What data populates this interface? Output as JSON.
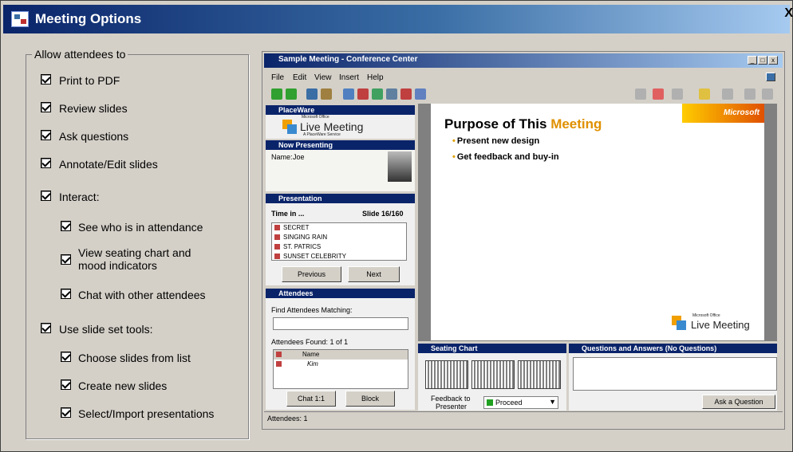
{
  "window": {
    "title": "Meeting Options",
    "close": "X"
  },
  "options": {
    "legend": "Allow attendees to",
    "items": [
      {
        "label": "Print to PDF",
        "checked": true
      },
      {
        "label": "Review slides",
        "checked": true
      },
      {
        "label": "Ask questions",
        "checked": true
      },
      {
        "label": "Annotate/Edit slides",
        "checked": true
      },
      {
        "label": "Interact:",
        "checked": true
      },
      {
        "label": "See who is in attendance",
        "checked": true
      },
      {
        "label": "View seating chart and",
        "label2": "mood indicators",
        "checked": true
      },
      {
        "label": "Chat with other attendees",
        "checked": true
      },
      {
        "label": "Use slide set tools:",
        "checked": true
      },
      {
        "label": "Choose slides from list",
        "checked": true
      },
      {
        "label": "Create new slides",
        "checked": true
      },
      {
        "label": "Select/Import presentations",
        "checked": true
      }
    ]
  },
  "preview": {
    "title": "Sample Meeting - Conference Center",
    "menu": [
      "File",
      "Edit",
      "View",
      "Insert",
      "Help"
    ],
    "placeware": {
      "head": "PlaceWare",
      "logo_top": "Microsoft Office",
      "logo": "Live Meeting",
      "logo_sub": "A PlaceWare Service"
    },
    "now_presenting": {
      "head": "Now Presenting",
      "name_label": "Name:",
      "name": "Joe"
    },
    "presentation": {
      "head": "Presentation",
      "time": "Time in ...",
      "slide": "Slide 16/160",
      "slides": [
        "SECRET",
        "SINGING RAIN",
        "ST. PATRICS",
        "SUNSET CELEBRITY"
      ],
      "prev": "Previous",
      "next": "Next"
    },
    "attendees": {
      "head": "Attendees",
      "find_label": "Find Attendees Matching:",
      "found": "Attendees Found: 1 of 1",
      "col_name": "Name",
      "rows": [
        "Kim"
      ],
      "chat": "Chat 1:1",
      "block": "Block"
    },
    "slide": {
      "title_a": "Purpose of This ",
      "title_b": "Meeting",
      "bullets": [
        "Present new design",
        "Get feedback and buy-in"
      ],
      "brand": "Microsoft",
      "logo_top": "Microsoft Office",
      "logo": "Live Meeting"
    },
    "seating": {
      "head": "Seating Chart",
      "feedback_a": "Feedback to",
      "feedback_b": "Presenter",
      "feedback_value": "Proceed"
    },
    "qa": {
      "head": "Questions and Answers (No Questions)",
      "ask": "Ask a Question"
    },
    "status": "Attendees: 1"
  }
}
